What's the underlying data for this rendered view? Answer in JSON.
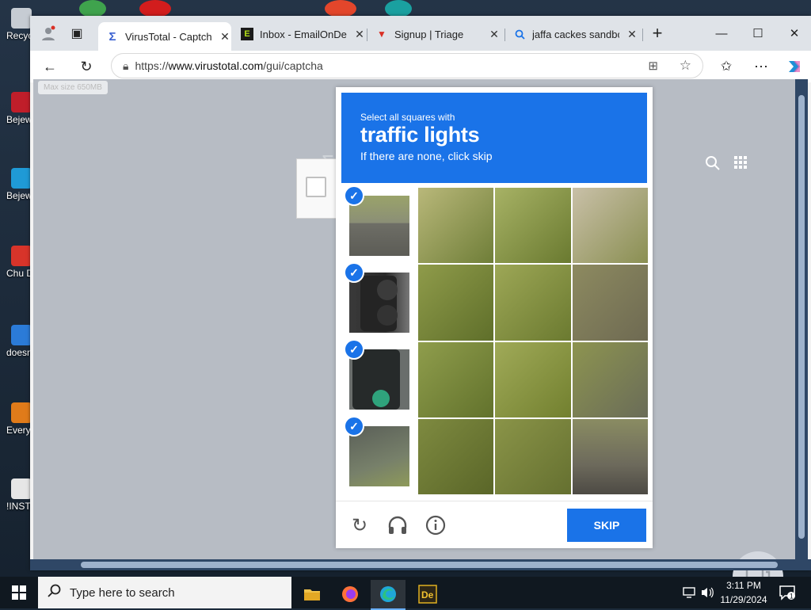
{
  "desktop": {
    "icons": [
      {
        "label": "Recycle"
      },
      {
        "label": "Bejewe Del"
      },
      {
        "label": "Bejew Del"
      },
      {
        "label": "Chu Del"
      },
      {
        "label": "doesn"
      },
      {
        "label": "Every"
      },
      {
        "label": "!INSTA"
      }
    ]
  },
  "tabs": [
    {
      "title": "VirusTotal - Captcha",
      "icon": "virustotal-icon",
      "active": true
    },
    {
      "title": "Inbox - EmailOnDec",
      "icon": "e-icon",
      "active": false
    },
    {
      "title": "Signup | Triage",
      "icon": "triage-icon",
      "active": false
    },
    {
      "title": "jaffa cackes sandbox",
      "icon": "search-icon",
      "active": false
    }
  ],
  "window": {
    "minimize": "—",
    "maximize": "☐",
    "close": "✕",
    "new_tab": "+"
  },
  "address": {
    "prefix": "https://",
    "domain": "www.virustotal.com",
    "path": "/gui/captcha"
  },
  "page": {
    "max_size_tooltip": "Max size 650MB"
  },
  "captcha": {
    "instruction": "Select all squares with",
    "target": "traffic lights",
    "hint": "If there are none, click skip",
    "selected_thumbs": 4,
    "skip_label": "SKIP"
  },
  "taskbar": {
    "search_placeholder": "Type here to search",
    "time": "3:11 PM",
    "date": "11/29/2024",
    "notification_count": "1"
  }
}
